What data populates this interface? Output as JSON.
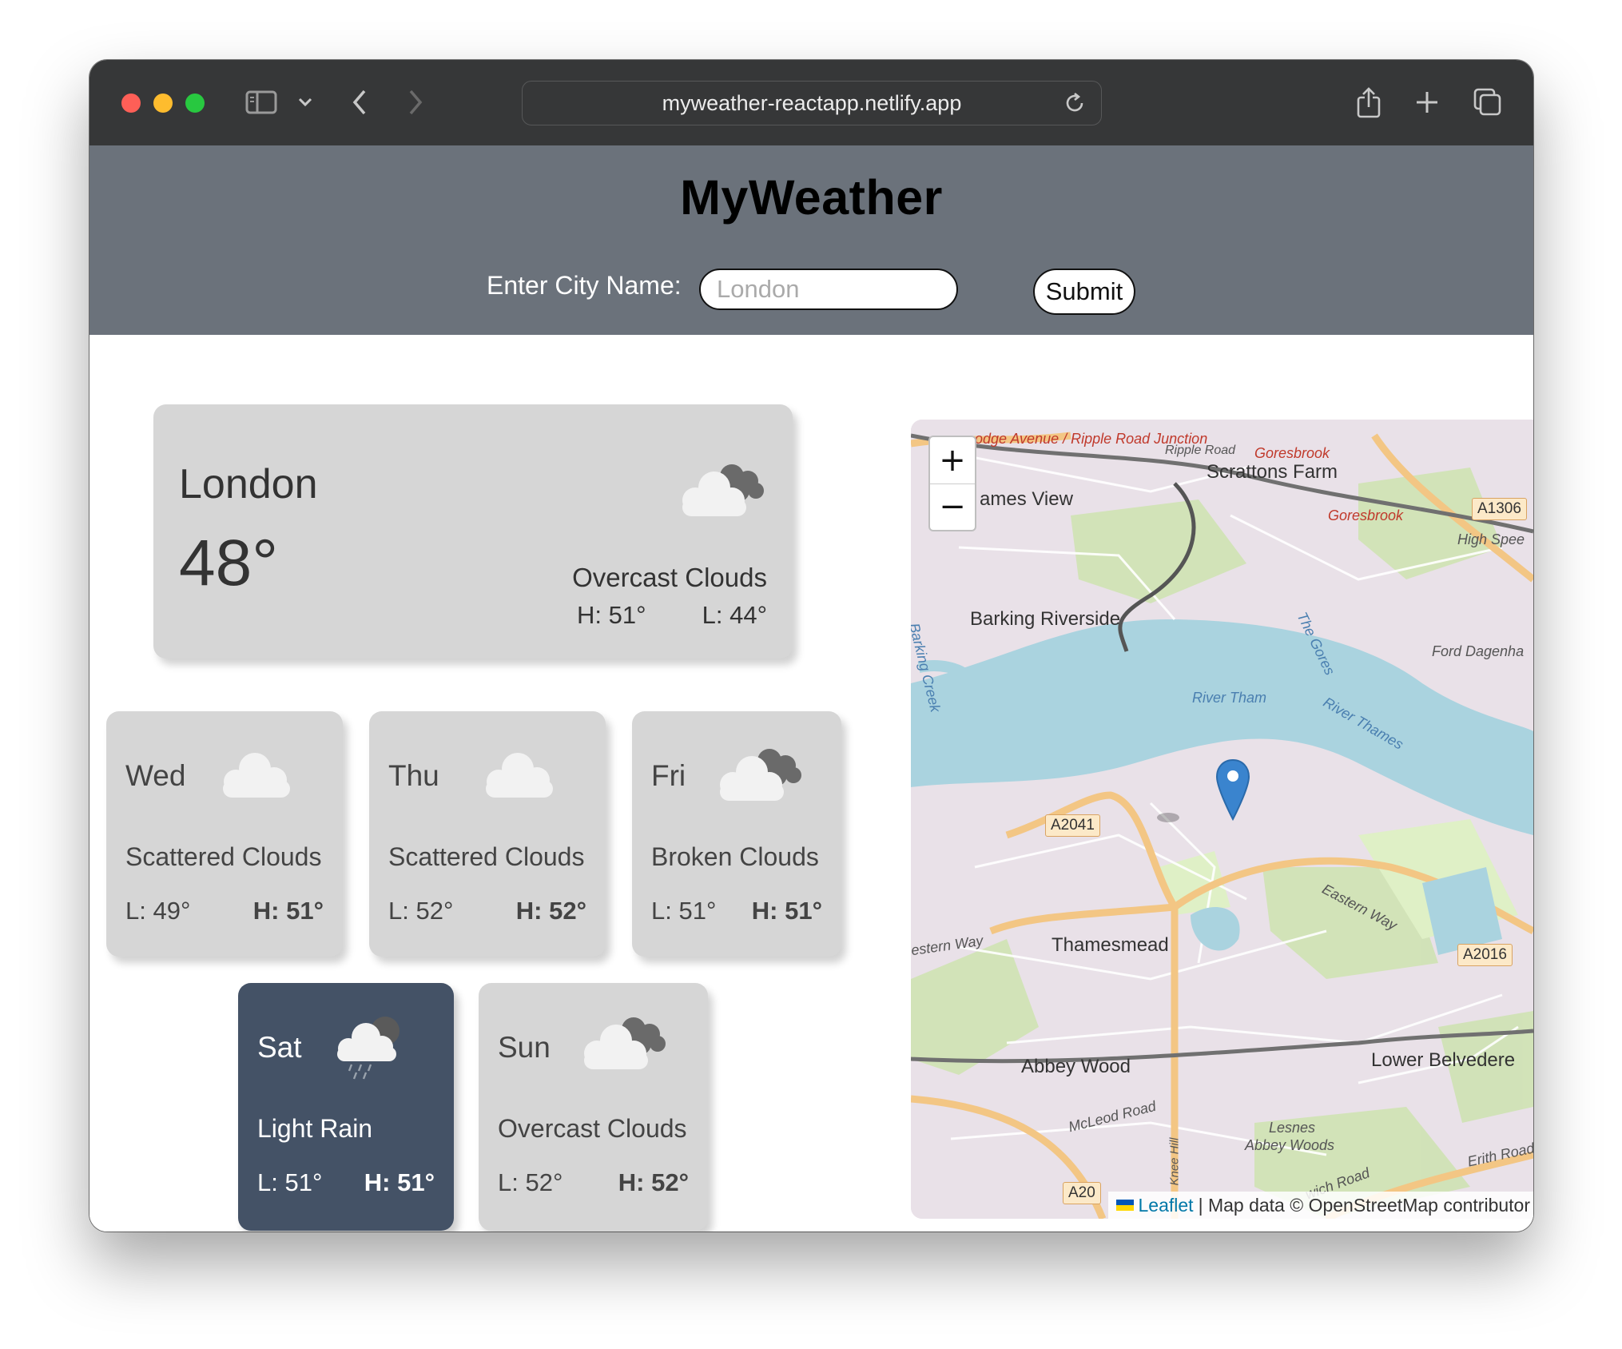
{
  "browser": {
    "url": "myweather-reactapp.netlify.app"
  },
  "header": {
    "title": "MyWeather",
    "city_label": "Enter City Name:",
    "city_placeholder": "London",
    "submit_label": "Submit"
  },
  "current": {
    "city": "London",
    "temp": "48°",
    "description": "Overcast Clouds",
    "high": "H: 51°",
    "low": "L: 44°",
    "icon": "overcast-clouds-icon"
  },
  "forecast": [
    {
      "day": "Wed",
      "description": "Scattered Clouds",
      "low": "L: 49°",
      "high": "H: 51°",
      "icon": "scattered-clouds-icon"
    },
    {
      "day": "Thu",
      "description": "Scattered Clouds",
      "low": "L: 52°",
      "high": "H: 52°",
      "icon": "scattered-clouds-icon"
    },
    {
      "day": "Fri",
      "description": "Broken Clouds",
      "low": "L: 51°",
      "high": "H: 51°",
      "icon": "broken-clouds-icon"
    },
    {
      "day": "Sat",
      "description": "Light Rain",
      "low": "L: 51°",
      "high": "H: 51°",
      "icon": "light-rain-icon",
      "selected": true
    },
    {
      "day": "Sun",
      "description": "Overcast Clouds",
      "low": "L: 52°",
      "high": "H: 52°",
      "icon": "overcast-clouds-icon"
    }
  ],
  "map": {
    "zoom_in": "+",
    "zoom_out": "−",
    "attribution_link": "Leaflet",
    "attribution_text": "| Map data © OpenStreetMap contributor",
    "labels": [
      "odge Avenue / Ripple Road Junction",
      "Ripple Road",
      "Goresbrook",
      "Scrattons Farm",
      "ames View",
      "Goresbrook",
      "A1306",
      "High Spee",
      "Barking Riverside",
      "Ford Dagenha",
      "River Tham",
      "The Gores",
      "River Thames",
      "A2041",
      "Eastern Way",
      "Thamesmead",
      "estern Way",
      "A2016",
      "Abbey Wood",
      "Lower Belvedere",
      "McLeod Road",
      "Lesnes",
      "Abbey Woods",
      "Knee Hill",
      "Erith Road",
      "wich Road",
      "A20",
      "Barking Creek"
    ]
  },
  "colors": {
    "header_bg": "#6b727b",
    "card_bg": "#d6d6d6",
    "selected_card_bg": "#445266",
    "titlebar_bg": "#363738"
  }
}
